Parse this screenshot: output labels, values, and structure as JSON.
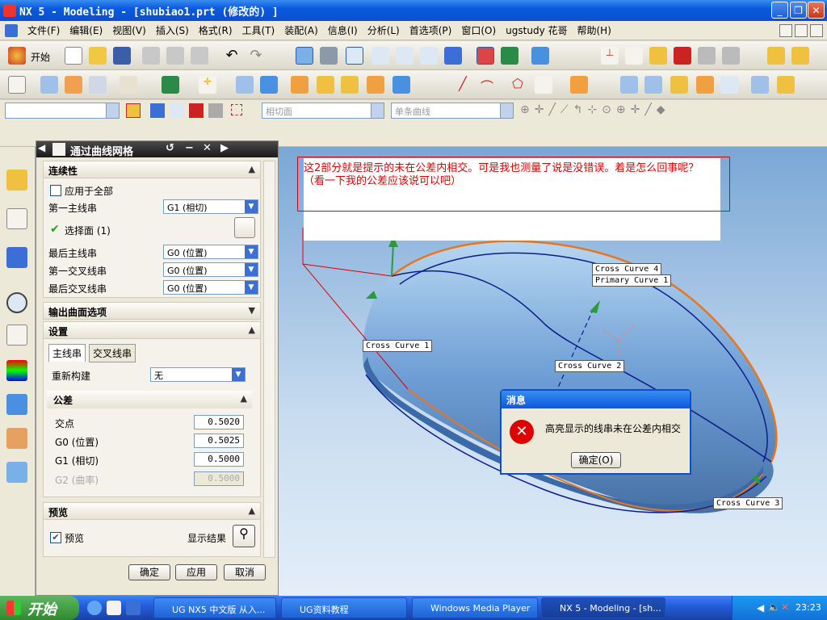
{
  "window": {
    "title": "NX 5 - Modeling - [shubiao1.prt  (修改的) ]"
  },
  "menu": [
    "文件(F)",
    "编辑(E)",
    "视图(V)",
    "插入(S)",
    "格式(R)",
    "工具(T)",
    "装配(A)",
    "信息(I)",
    "分析(L)",
    "首选项(P)",
    "窗口(O)",
    "ugstudy 花哥",
    "帮助(H)"
  ],
  "toolbar": {
    "start_label": "开始"
  },
  "selection": {
    "filter2": "相切面",
    "filter3": "单条曲线"
  },
  "dialog": {
    "title": "通过曲线网格",
    "continuity": {
      "header": "连续性",
      "apply_all": "应用于全部",
      "first_primary_label": "第一主线串",
      "first_primary_value": "G1 (相切)",
      "select_face": "选择面 (1)",
      "last_primary_label": "最后主线串",
      "last_primary_value": "G0 (位置)",
      "first_cross_label": "第一交叉线串",
      "first_cross_value": "G0 (位置)",
      "last_cross_label": "最后交叉线串",
      "last_cross_value": "G0 (位置)"
    },
    "output_header": "输出曲面选项",
    "settings": {
      "header": "设置",
      "tab_primary": "主线串",
      "tab_cross": "交叉线串",
      "rebuild_label": "重新构建",
      "rebuild_value": "无",
      "tol_header": "公差",
      "intersect_label": "交点",
      "intersect_value": "0.5020",
      "g0_label": "G0 (位置)",
      "g0_value": "0.5025",
      "g1_label": "G1 (相切)",
      "g1_value": "0.5000",
      "g2_label": "G2 (曲率)",
      "g2_value": "0.5000"
    },
    "preview": {
      "header": "预览",
      "preview_label": "预览",
      "show_result": "显示结果"
    },
    "buttons": {
      "ok": "确定",
      "apply": "应用",
      "cancel": "取消"
    }
  },
  "annotation": {
    "text": "这2部分就是提示的未在公差内相交。可是我也测量了说是没错误。着是怎么回事呢？（看一下我的公差应该说可以吧）"
  },
  "curve_labels": {
    "cc4": "Cross Curve  4",
    "pc1": "Primary Curve  1",
    "cc1": "Cross Curve  1",
    "cc2": "Cross Curve  2",
    "cc3": "Cross Curve  3"
  },
  "message": {
    "title": "消息",
    "text": "高亮显示的线串未在公差内相交",
    "ok": "确定(O)"
  },
  "taskbar": {
    "start": "开始",
    "tasks": [
      "UG NX5 中文版 从入...",
      "UG资料教程",
      "Windows Media Player",
      "NX 5 - Modeling - [sh..."
    ],
    "clock": "23:23"
  },
  "colors": {
    "accent": "#0a5adf",
    "error": "#d00000",
    "curve_orange": "#e8761c",
    "curve_blue": "#0c1c8c"
  }
}
